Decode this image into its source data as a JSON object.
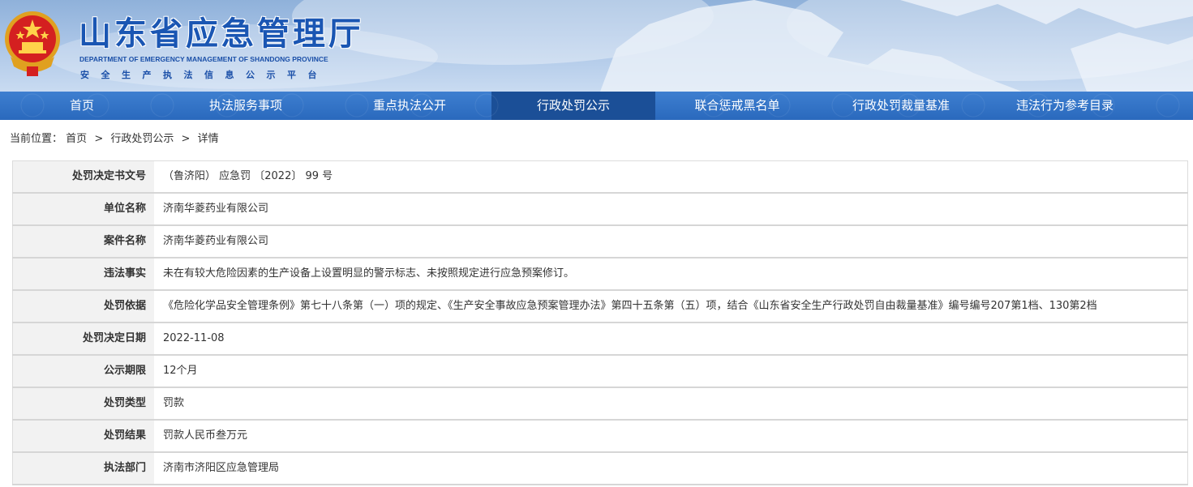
{
  "header": {
    "title": "山东省应急管理厅",
    "subtitle_en": "DEPARTMENT OF EMERGENCY MANAGEMENT OF SHANDONG PROVINCE",
    "subtitle_cn": "安全生产执法信息公示平台",
    "emblem_icon": "national-emblem-icon"
  },
  "nav": {
    "items": [
      {
        "label": "首页"
      },
      {
        "label": "执法服务事项"
      },
      {
        "label": "重点执法公开"
      },
      {
        "label": "行政处罚公示"
      },
      {
        "label": "联合惩戒黑名单"
      },
      {
        "label": "行政处罚裁量基准"
      },
      {
        "label": "违法行为参考目录"
      }
    ],
    "active_index": 3
  },
  "breadcrumb": {
    "prefix": "当前位置：",
    "items": [
      "首页",
      "行政处罚公示",
      "详情"
    ],
    "separator": ">"
  },
  "detail": {
    "rows": [
      {
        "label": "处罚决定书文号",
        "value": "（鲁济阳） 应急罚 〔2022〕 99 号"
      },
      {
        "label": "单位名称",
        "value": "济南华菱药业有限公司"
      },
      {
        "label": "案件名称",
        "value": "济南华菱药业有限公司"
      },
      {
        "label": "违法事实",
        "value": "未在有较大危险因素的生产设备上设置明显的警示标志、未按照规定进行应急预案修订。"
      },
      {
        "label": "处罚依据",
        "value": "《危险化学品安全管理条例》第七十八条第（一）项的规定、《生产安全事故应急预案管理办法》第四十五条第（五）项，结合《山东省安全生产行政处罚自由裁量基准》编号编号207第1档、130第2档"
      },
      {
        "label": "处罚决定日期",
        "value": "2022-11-08"
      },
      {
        "label": "公示期限",
        "value": "12个月"
      },
      {
        "label": "处罚类型",
        "value": "罚款"
      },
      {
        "label": "处罚结果",
        "value": "罚款人民币叁万元"
      },
      {
        "label": "执法部门",
        "value": "济南市济阳区应急管理局"
      }
    ]
  },
  "colors": {
    "nav_bg": "#2f6fc4",
    "nav_active": "#1b4f97",
    "title_blue": "#1a56b3",
    "label_bg": "#f2f2f2"
  }
}
